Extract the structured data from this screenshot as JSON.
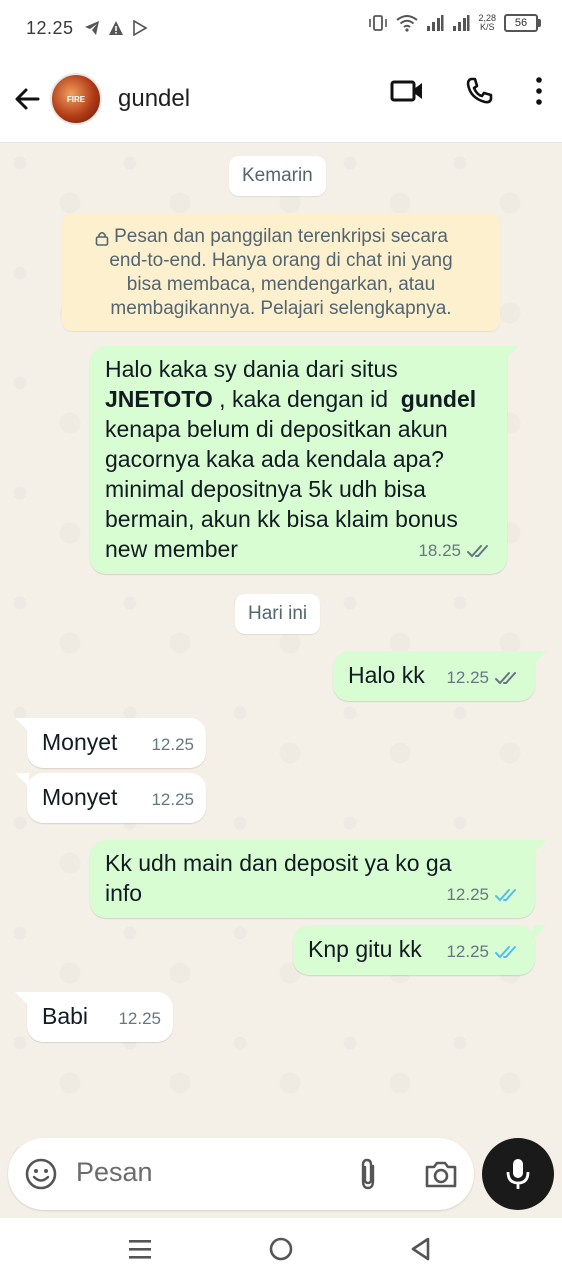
{
  "status_bar": {
    "time": "12.25",
    "net_speed_top": "2,28",
    "net_speed_bottom": "K/S",
    "battery": "56"
  },
  "header": {
    "contact_name": "gundel",
    "avatar_text": "FIRE"
  },
  "chat": {
    "date_yesterday": "Kemarin",
    "encryption_notice": "Pesan dan panggilan terenkripsi secara\nend-to-end. Hanya orang di chat ini yang\nbisa membaca, mendengarkan, atau\nmembagikannya. Pelajari selengkapnya.",
    "date_today": "Hari ini",
    "messages": [
      {
        "dir": "out",
        "time": "18.25",
        "status": "delivered",
        "p1": "Halo kaka sy dania dari situs\n",
        "b1": "JNETOTO",
        "p2": " , kaka dengan id  ",
        "b2": "gundel",
        "p3": "\nkenapa belum di depositkan akun\ngacornya kaka ada kendala apa?\nminimal depositnya 5k udh bisa\nbermain, akun kk bisa klaim bonus\nnew member"
      },
      {
        "dir": "out",
        "time": "12.25",
        "status": "delivered",
        "text": "Halo kk"
      },
      {
        "dir": "in",
        "time": "12.25",
        "text": "Monyet"
      },
      {
        "dir": "in",
        "time": "12.25",
        "text": "Monyet"
      },
      {
        "dir": "out",
        "time": "12.25",
        "status": "read",
        "text": "Kk udh main dan deposit ya ko ga\ninfo"
      },
      {
        "dir": "out",
        "time": "12.25",
        "status": "read",
        "text": "Knp gitu kk"
      },
      {
        "dir": "in",
        "time": "12.25",
        "text": "Babi"
      }
    ]
  },
  "input": {
    "placeholder": "Pesan"
  },
  "colors": {
    "outgoing": "#d9fdd3",
    "incoming": "#ffffff",
    "read_ticks": "#53bdeb",
    "delivered_ticks": "#667781",
    "encryption_bg": "#fdf0cf"
  },
  "icons": [
    "back-arrow-icon",
    "video-call-icon",
    "voice-call-icon",
    "more-menu-icon",
    "lock-icon",
    "sticker-icon",
    "attach-icon",
    "camera-icon",
    "mic-icon",
    "nav-menu-icon",
    "nav-home-icon",
    "nav-back-icon"
  ]
}
